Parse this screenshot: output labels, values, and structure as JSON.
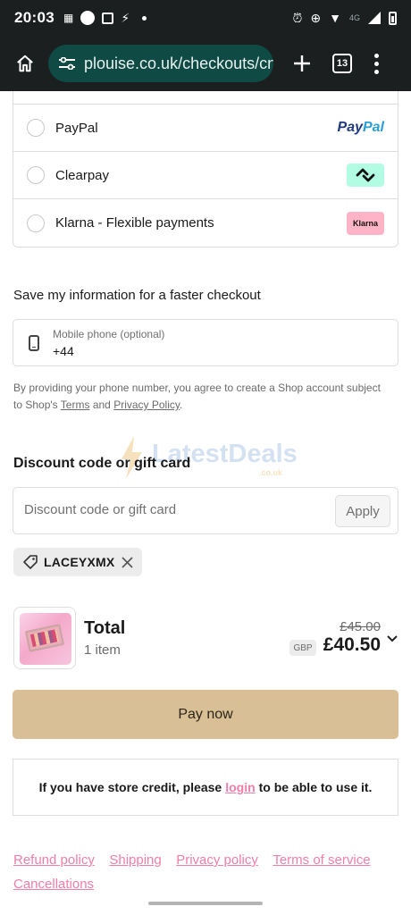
{
  "status_bar": {
    "time": "20:03",
    "network": "4G"
  },
  "browser": {
    "url": "plouise.co.uk/checkouts/cn/",
    "tab_count": "13"
  },
  "payment_methods": [
    {
      "label": "PayPal",
      "logo": "PayPal",
      "logo_part1": "Pay",
      "logo_part2": "Pal"
    },
    {
      "label": "Clearpay",
      "logo": "clearpay-icon"
    },
    {
      "label": "Klarna - Flexible payments",
      "logo": "Klarna"
    }
  ],
  "save_info": {
    "title": "Save my information for a faster checkout",
    "phone_label": "Mobile phone (optional)",
    "phone_value": "+44",
    "terms_prefix": "By providing your phone number, you agree to create a Shop account subject to Shop's",
    "terms_link": "Terms",
    "terms_and": "and",
    "privacy_link": "Privacy Policy",
    "terms_suffix": "."
  },
  "watermark": {
    "text": "LatestDeals",
    "sub": ".co.uk"
  },
  "discount": {
    "title": "Discount code or gift card",
    "placeholder": "Discount code or gift card",
    "apply_label": "Apply",
    "applied_code": "LACEYXMX"
  },
  "summary": {
    "total_label": "Total",
    "items_count": "1 item",
    "old_price": "£45.00",
    "currency": "GBP",
    "new_price": "£40.50"
  },
  "pay_now_label": "Pay now",
  "store_credit": {
    "prefix": "If you have store credit, please",
    "link": "login",
    "suffix": "to be able to use it."
  },
  "footer_links": [
    "Refund policy",
    "Shipping",
    "Privacy policy",
    "Terms of service",
    "Cancellations"
  ],
  "colors": {
    "accent_button": "#d9bf96",
    "link_pink": "#f07ea8",
    "browser_bar": "#1b1f1f",
    "url_pill": "#0f4a45"
  }
}
